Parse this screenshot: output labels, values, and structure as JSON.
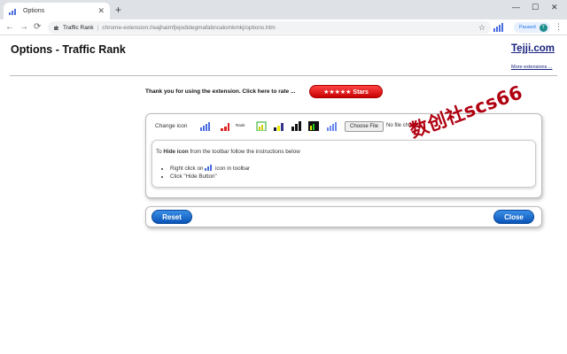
{
  "browser": {
    "tab_title": "Options",
    "new_tab": "+",
    "minimize": "—",
    "maximize": "☐",
    "close": "✕",
    "back": "←",
    "forward": "→",
    "reload": "⟳",
    "site_name": "Traffic Rank",
    "url": "chrome-extension://eajhaimfjejodidegmafabncalomkmkj/options.htm",
    "star": "☆",
    "paused_label": "Paused",
    "avatar_letter": "T",
    "menu": "⋮"
  },
  "header": {
    "title": "Options - Traffic Rank",
    "brand": "Tejji.com",
    "more_extensions": "More extensions ..."
  },
  "rate": {
    "text": "Thank you for using the extension. Click here to rate ...",
    "button": "★★★★★ Stars"
  },
  "options": {
    "change_icon_label": "Change icon",
    "icon_options": [
      "bars-blue",
      "bars-red",
      "rank-text",
      "bars-yellow-green",
      "bars-blue-yellow",
      "bars-black",
      "bars-black-green",
      "bars-blue-light"
    ],
    "rank_text": "Rank",
    "file_button": "Choose File",
    "file_status": "No file chosen"
  },
  "hide_help": {
    "intro_prefix": "To ",
    "intro_bold": "Hide icon",
    "intro_suffix": " from the toolbar follow the instructions below",
    "step1_prefix": "Right click on ",
    "step1_suffix": " icon in toolbar",
    "step2": "Click \"Hide Button\""
  },
  "buttons": {
    "reset": "Reset",
    "close": "Close"
  },
  "watermark": "数创社scs66",
  "colors": {
    "accent_blue": "#0a55b8",
    "stars_red": "#c80000",
    "brand_navy": "#1a237e",
    "watermark_red": "#b00010"
  }
}
